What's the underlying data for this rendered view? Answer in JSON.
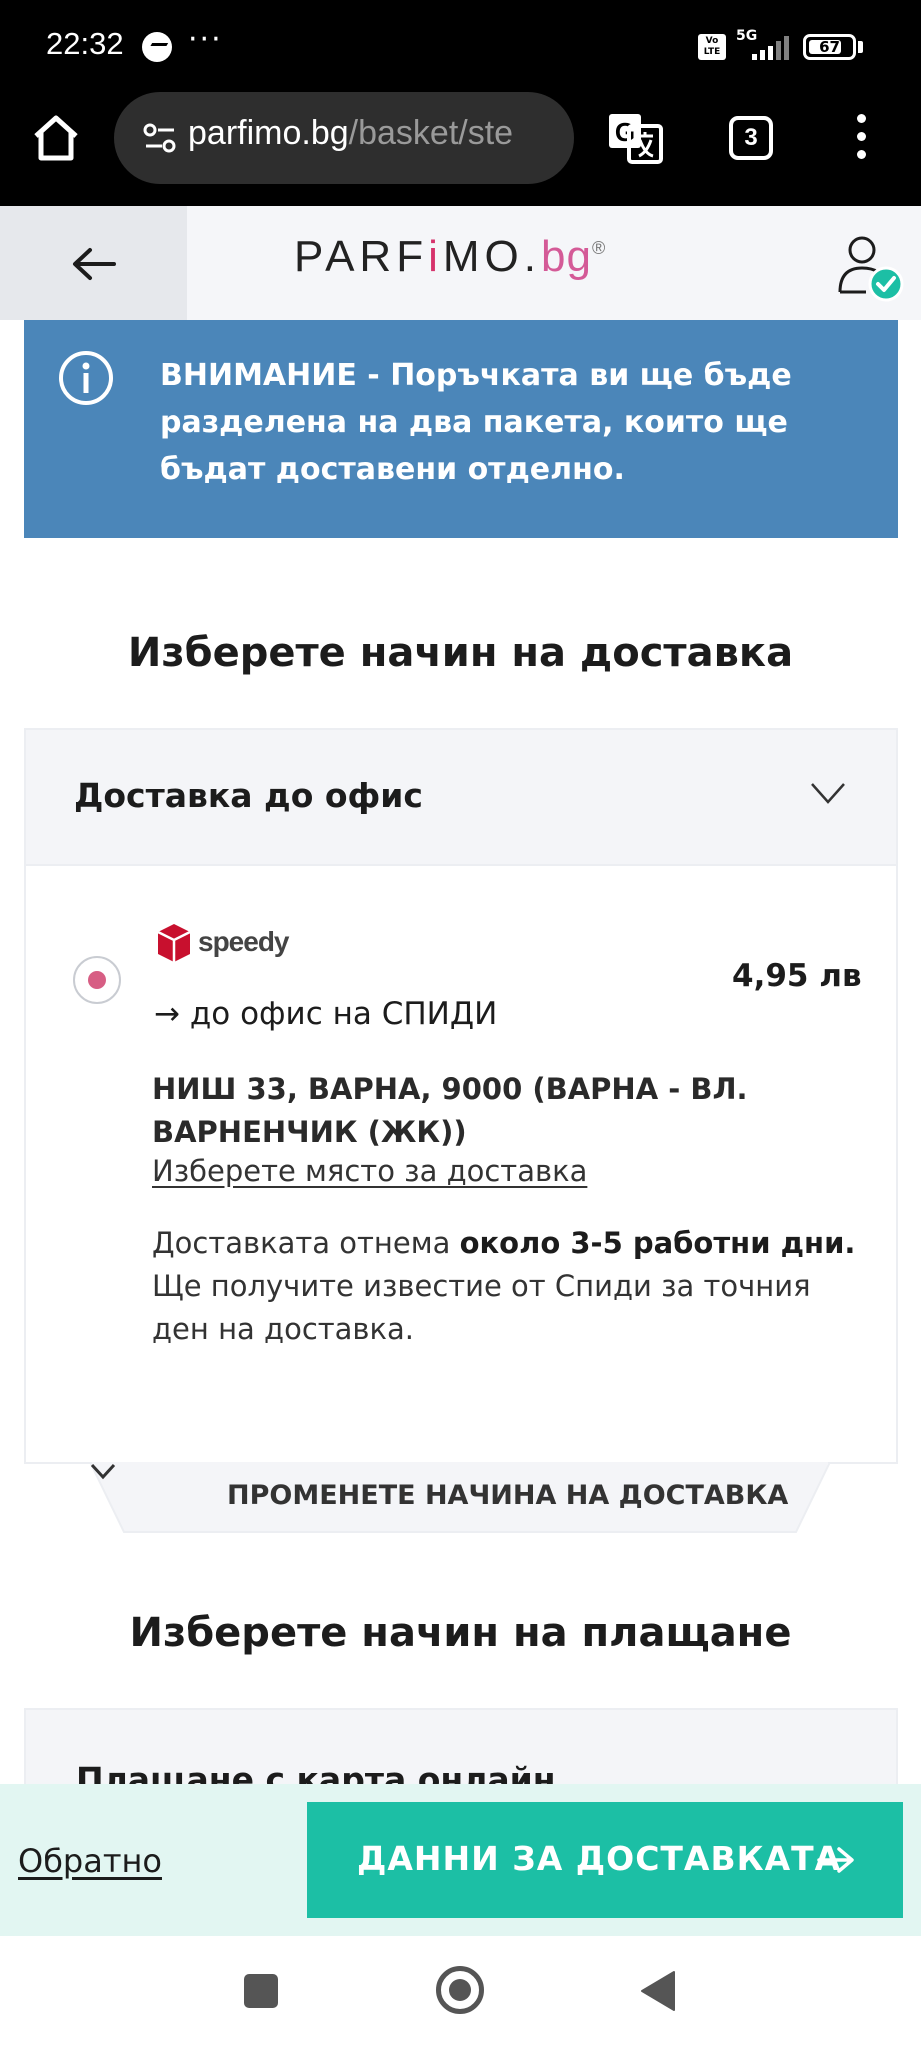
{
  "status_bar": {
    "time": "22:32",
    "dots": "···",
    "volte": "Vo LTE",
    "network": "5G",
    "battery": "67"
  },
  "browser": {
    "url_domain": "parfimo.bg",
    "url_path": "/basket/ste",
    "tab_count": "3"
  },
  "header": {
    "logo_prefix": "PARF",
    "logo_i": "i",
    "logo_suffix": "MO.",
    "logo_tld": "bg",
    "logo_mark": "®"
  },
  "notice": {
    "text": "ВНИМАНИЕ - Поръчката ви ще бъде разделена на два пакета, които ще бъдат доставени отделно."
  },
  "delivery": {
    "section_title": "Изберете начин на доставка",
    "method_title": "Доставка до офис",
    "carrier_name": "speedy",
    "price": "4,95 лв",
    "office_line": "→ до офис на СПИДИ",
    "address": "НИШ 33, ВАРНА, 9000 (ВАРНА - ВЛ. ВАРНЕНЧИК (ЖК))",
    "choose_place": "Изберете място за доставка",
    "info_prefix": "Доставката отнема ",
    "info_bold": "около 3-5 работни дни.",
    "info_suffix": " Ще получите известие от Спиди за точния ден на доставка.",
    "change_label": "ПРОМЕНЕТЕ НАЧИНА НА ДОСТАВКА"
  },
  "payment": {
    "section_title": "Изберете начин на плащане",
    "method_title": "Плащане с карта онлайн"
  },
  "actions": {
    "back_label": "Обратно",
    "next_label": "ДАННИ ЗА ДОСТАВКАТА"
  },
  "colors": {
    "notice_bg": "#4b86b9",
    "accent_teal": "#1cbfa5",
    "radio_pink": "#d75e84",
    "brand_pink": "#d45a97"
  }
}
